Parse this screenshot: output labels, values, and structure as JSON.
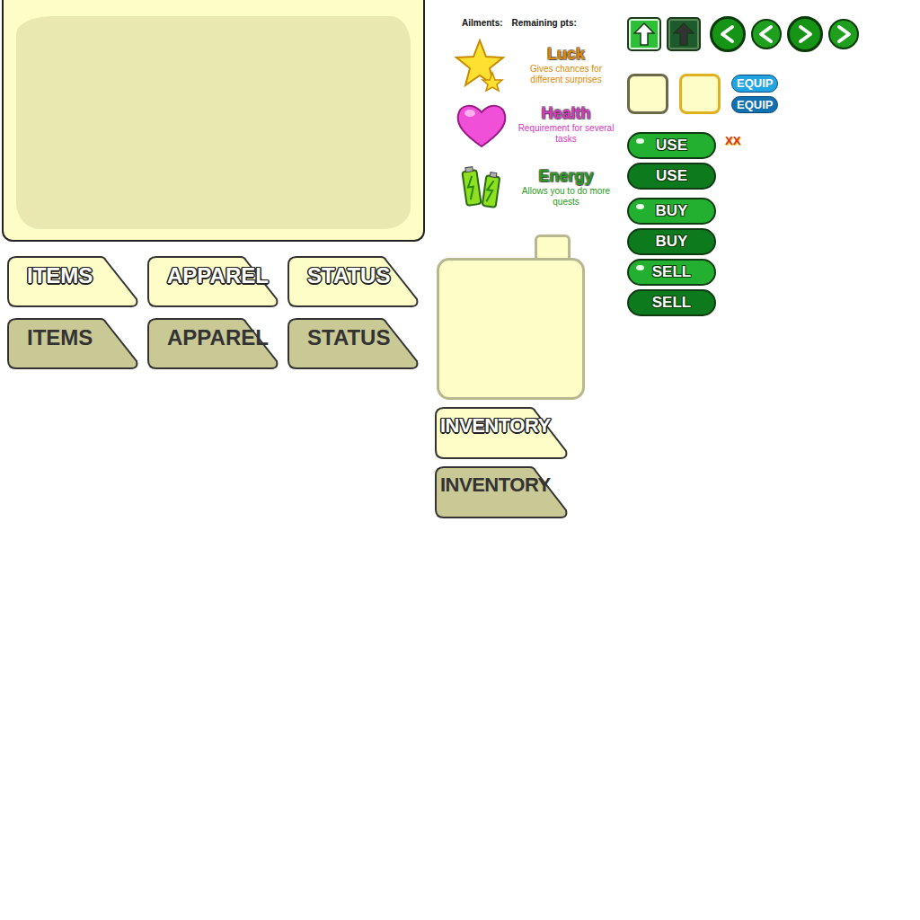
{
  "tab_rows": [
    [
      {
        "label": "ITEMS",
        "selected": true
      },
      {
        "label": "APPAREL",
        "selected": true
      },
      {
        "label": "STATUS",
        "selected": true
      }
    ],
    [
      {
        "label": "ITEMS",
        "selected": false
      },
      {
        "label": "APPAREL",
        "selected": false
      },
      {
        "label": "STATUS",
        "selected": false
      }
    ]
  ],
  "stats_header": [
    "Ailments:",
    "Remaining pts:"
  ],
  "stats": [
    {
      "name": "Luck",
      "description": "Gives chances for different surprises",
      "color": "#e08a00",
      "kind": "star"
    },
    {
      "name": "Health",
      "description": "Requirement for several tasks",
      "color": "#d838c0",
      "kind": "heart"
    },
    {
      "name": "Energy",
      "description": "Allows you to do more quests",
      "color": "#2a9a20",
      "kind": "battery"
    }
  ],
  "nav_buttons": [
    {
      "kind": "up",
      "pressed": false
    },
    {
      "kind": "up",
      "pressed": true
    },
    {
      "kind": "left",
      "pressed": false
    },
    {
      "kind": "left",
      "pressed": true
    },
    {
      "kind": "right",
      "pressed": false
    },
    {
      "kind": "right",
      "pressed": true
    }
  ],
  "slots": [
    {
      "selected": false
    },
    {
      "selected": true
    }
  ],
  "equip_buttons": [
    {
      "label": "EQUIP",
      "pressed": false
    },
    {
      "label": "EQUIP",
      "pressed": true
    }
  ],
  "action_buttons": [
    {
      "label": "USE",
      "pressed": false
    },
    {
      "label": "USE",
      "pressed": true
    },
    {
      "label": "BUY",
      "pressed": false
    },
    {
      "label": "BUY",
      "pressed": true
    },
    {
      "label": "SELL",
      "pressed": false
    },
    {
      "label": "SELL",
      "pressed": true
    }
  ],
  "close_mark": "XX",
  "inventory_tabs": [
    {
      "label": "INVENTORY",
      "selected": true
    },
    {
      "label": "INVENTORY",
      "selected": false
    }
  ]
}
